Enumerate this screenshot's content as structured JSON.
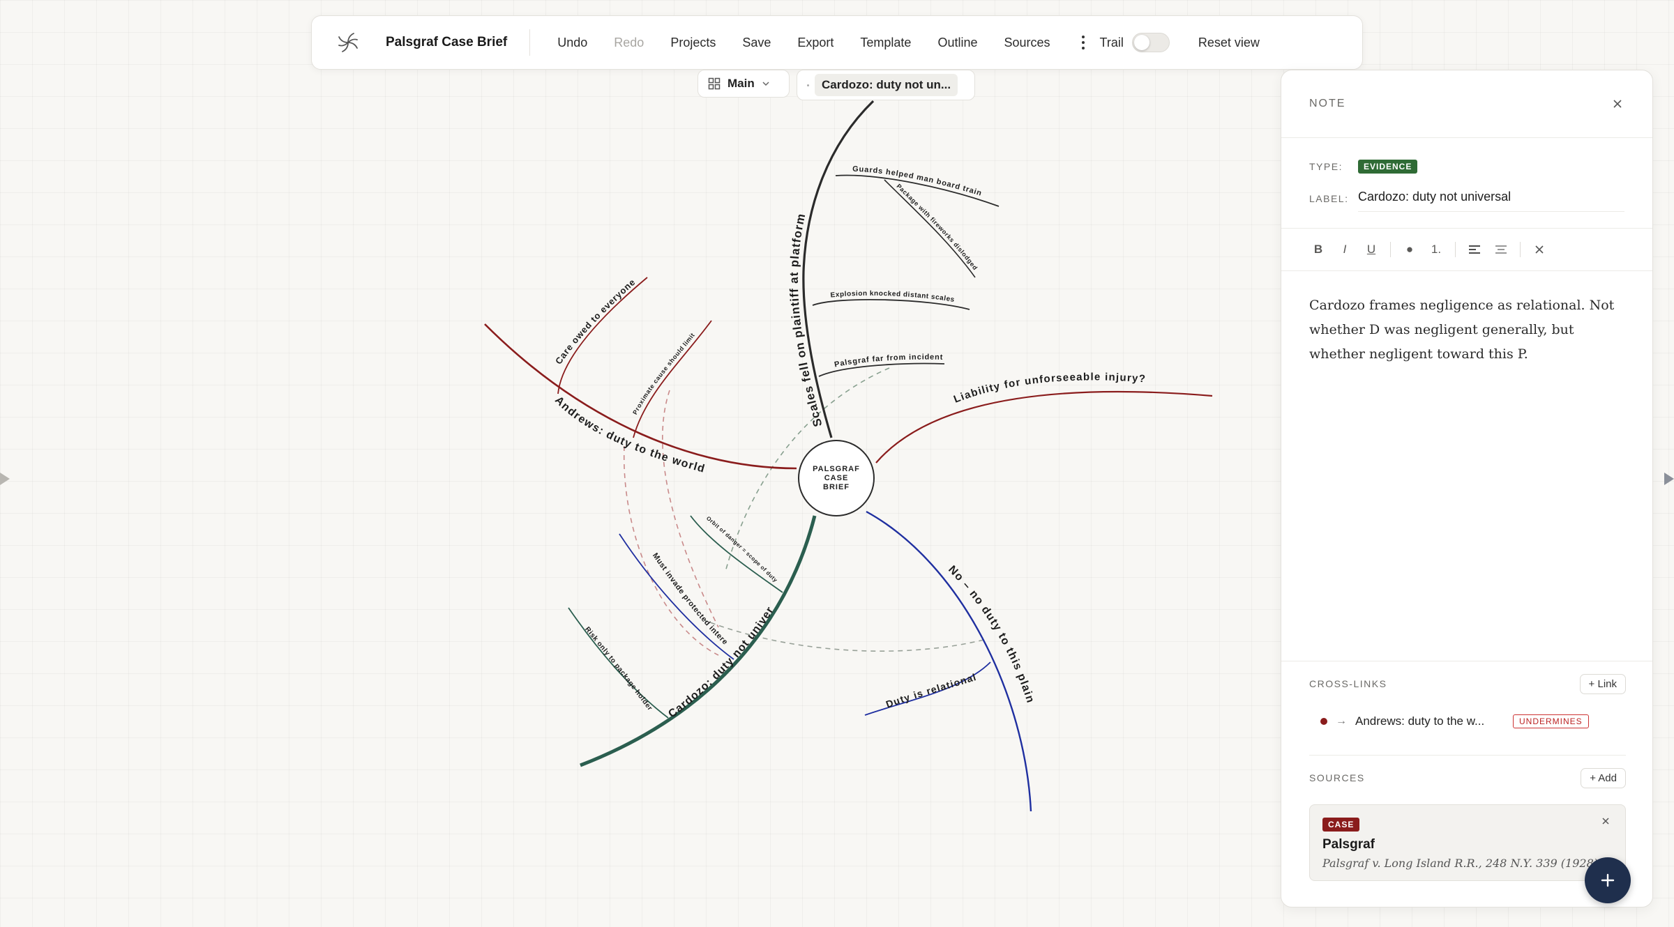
{
  "toolbar": {
    "title": "Palsgraf Case Brief",
    "undo": "Undo",
    "redo": "Redo",
    "projects": "Projects",
    "save": "Save",
    "export": "Export",
    "template": "Template",
    "outline": "Outline",
    "sources": "Sources",
    "trail": "Trail",
    "trail_on": false,
    "reset_view": "Reset view"
  },
  "view": {
    "selector": "Main",
    "breadcrumb": "Cardozo: duty not un..."
  },
  "map": {
    "hub": "PALSGRAF CASE BRIEF",
    "branches": [
      {
        "label": "Scales fell on plaintiff at platform",
        "color": "#2b2b2b"
      },
      {
        "label": "Andrews: duty to the world",
        "color": "#8a1c1c"
      },
      {
        "label": "Liability for unforseeable injury?",
        "color": "#8a1c1c"
      },
      {
        "label": "Cardozo: duty not universal",
        "color": "#2b5e4f"
      },
      {
        "label": "No – no duty to this plaintiff",
        "color": "#1f2fa0"
      }
    ],
    "leaves": {
      "guards": "Guards helped man board train",
      "package": "Package with fireworks dislodged",
      "explosion": "Explosion knocked distant scales",
      "palsgraf_far": "Palsgraf far from incident",
      "care_owed": "Care owed to everyone",
      "proximate": "Proximate cause should limit",
      "orbit": "Orbit of danger = scope of duty",
      "must_invade": "Must invade protected interest",
      "risk_only": "Risk only to package holder",
      "relational": "Duty is relational"
    }
  },
  "note": {
    "header": "NOTE",
    "type_key": "TYPE:",
    "type_value": "EVIDENCE",
    "label_key": "LABEL:",
    "label_value": "Cardozo: duty not universal",
    "format_buttons": [
      "B",
      "I",
      "U",
      "●",
      "1."
    ],
    "body": "Cardozo frames negligence as relational. Not whether D was negligent generally, but whether negligent toward this P."
  },
  "cross_links": {
    "title": "CROSS-LINKS",
    "add": "+ Link",
    "items": [
      {
        "target": "Andrews: duty to the w...",
        "relation": "UNDERMINES",
        "color": "#8a1c1c"
      }
    ]
  },
  "sources": {
    "title": "SOURCES",
    "add": "+ Add",
    "items": [
      {
        "kind": "CASE",
        "title": "Palsgraf",
        "citation": "Palsgraf v. Long Island R.R., 248 N.Y. 339 (1928)"
      }
    ]
  },
  "fab": "+",
  "colors": {
    "evidence": "#2f6b35",
    "case": "#8a1c1c",
    "andrews": "#8a1c1c",
    "cardozo": "#2b5e4f",
    "no_duty": "#1f2fa0",
    "fab": "#1f2f4d"
  }
}
